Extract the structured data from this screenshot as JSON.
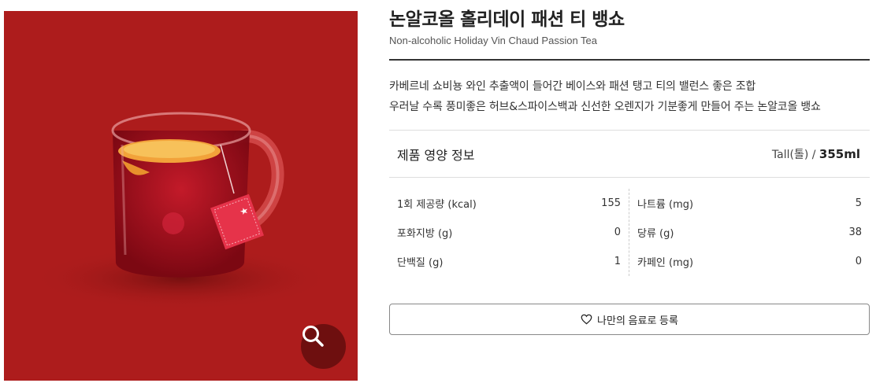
{
  "product": {
    "title": "논알코올 홀리데이 패션 티 뱅쇼",
    "subtitle": "Non-alcoholic Holiday Vin Chaud Passion Tea",
    "description_line1": "카베르네 쇼비뇽 와인 추출액이 들어간 베이스와 패션 탱고 티의 밸런스 좋은 조합",
    "description_line2": "우러날 수록 풍미좋은 허브&스파이스백과 신선한 오렌지가 기분좋게 만들어 주는 논알코올 뱅쇼"
  },
  "nutrition": {
    "heading": "제품 영양 정보",
    "size_label": "Tall(톨) / ",
    "size_value": "355ml",
    "left": [
      {
        "label": "1회 제공량 (kcal)",
        "value": "155"
      },
      {
        "label": "포화지방 (g)",
        "value": "0"
      },
      {
        "label": "단백질 (g)",
        "value": "1"
      }
    ],
    "right": [
      {
        "label": "나트륨 (mg)",
        "value": "5"
      },
      {
        "label": "당류 (g)",
        "value": "38"
      },
      {
        "label": "카페인 (mg)",
        "value": "0"
      }
    ]
  },
  "actions": {
    "register_label": "나만의 음료로 등록"
  },
  "icons": {
    "zoom": "magnifier-icon",
    "heart": "heart-outline-icon"
  },
  "colors": {
    "image_background": "#ad1c1c",
    "zoom_button": "#6e0f0f"
  }
}
